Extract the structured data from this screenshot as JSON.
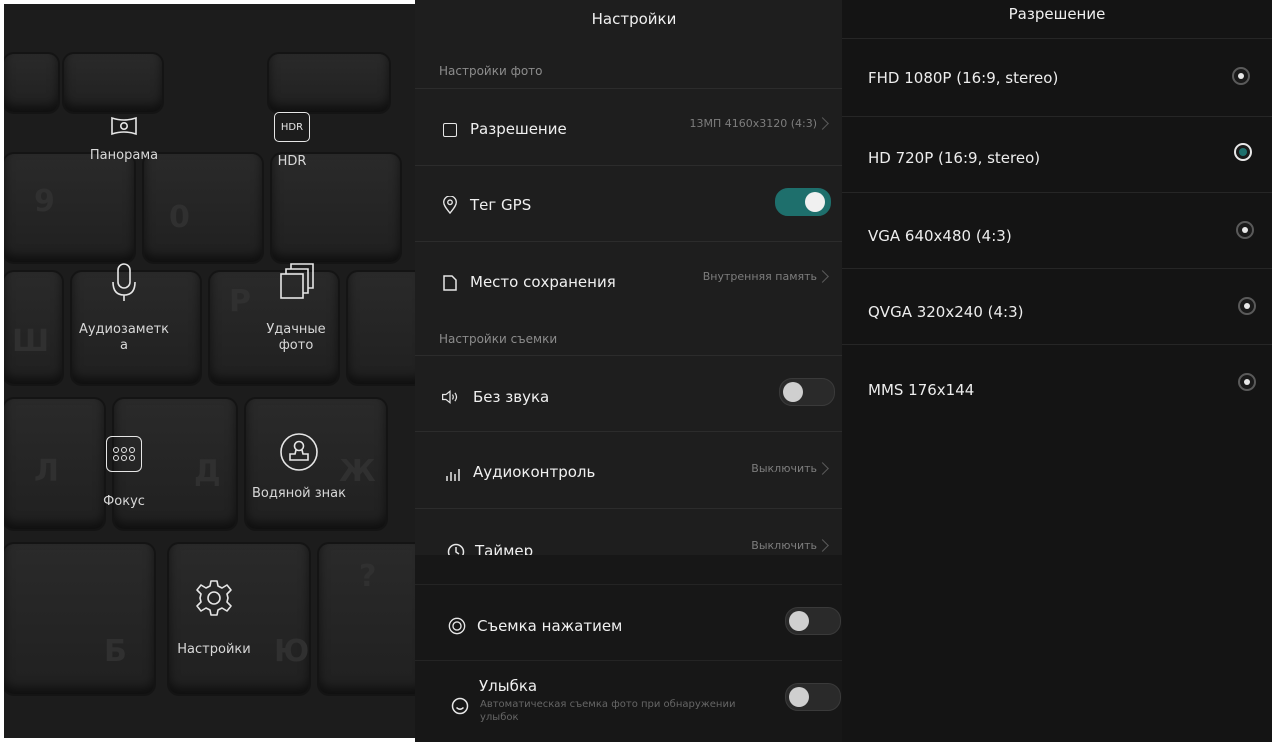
{
  "modes_panel": {
    "modes": [
      {
        "icon": "panorama-icon",
        "label": "Панорама"
      },
      {
        "icon": "hdr-icon",
        "label": "HDR",
        "badge": "HDR"
      },
      {
        "icon": "microphone-icon",
        "label": "Аудиозаметк\nа"
      },
      {
        "icon": "stacked-photos-icon",
        "label": "Удачные\nфото"
      },
      {
        "icon": "focus-grid-icon",
        "label": "Фокус"
      },
      {
        "icon": "stamp-icon",
        "label": "Водяной знак"
      },
      {
        "icon": "gear-icon",
        "label": "Настройки"
      }
    ]
  },
  "settings": {
    "title": "Настройки",
    "photo_section": "Настройки фото",
    "shooting_section": "Настройки съемки",
    "rows": {
      "resolution": {
        "label": "Разрешение",
        "value": "13МП 4160x3120 (4:3)"
      },
      "gps": {
        "label": "Тег GPS",
        "on": true
      },
      "storage": {
        "label": "Место сохранения",
        "value": "Внутренняя память"
      },
      "mute": {
        "label": "Без звука",
        "on": false
      },
      "audio_control": {
        "label": "Аудиоконтроль",
        "value": "Выключить"
      },
      "timer": {
        "label": "Таймер",
        "value": "Выключить"
      },
      "touch_capture": {
        "label": "Съемка нажатием",
        "on": false
      },
      "smile": {
        "label": "Улыбка",
        "description": "Автоматическая съемка фото при обнаружении улыбок",
        "on": false
      }
    },
    "accent_color": "#1e6f6c"
  },
  "resolution_panel": {
    "title": "Разрешение",
    "options": [
      {
        "label": "FHD 1080P (16:9, stereo)",
        "selected": false
      },
      {
        "label": "HD 720P (16:9, stereo)",
        "selected": true
      },
      {
        "label": "VGA 640x480 (4:3)",
        "selected": false
      },
      {
        "label": "QVGA 320x240 (4:3)",
        "selected": false
      },
      {
        "label": "MMS 176x144",
        "selected": false
      }
    ]
  }
}
